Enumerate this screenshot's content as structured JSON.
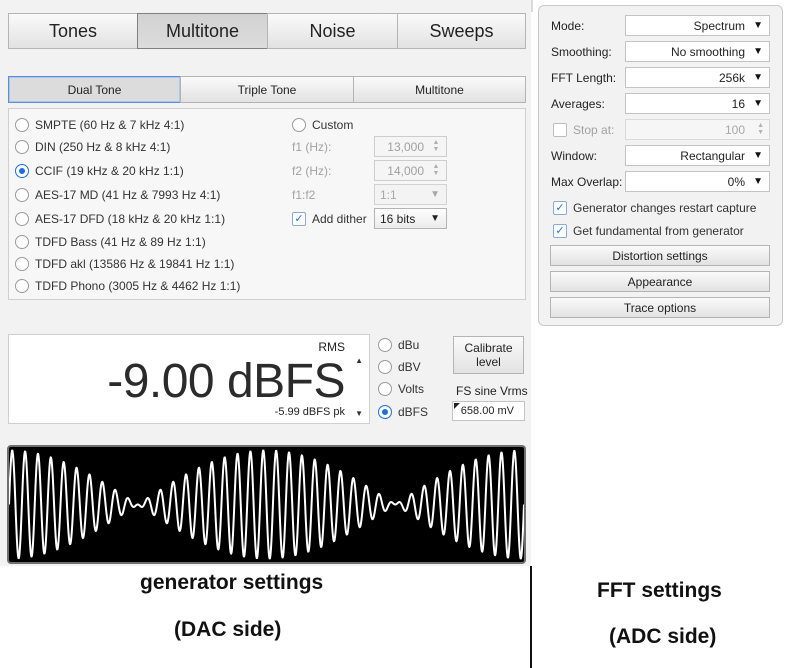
{
  "main_tabs": [
    "Tones",
    "Multitone",
    "Noise",
    "Sweeps"
  ],
  "sub_tabs": [
    "Dual Tone",
    "Triple Tone",
    "Multitone"
  ],
  "presets": [
    {
      "label": "SMPTE (60 Hz & 7 kHz 4:1)",
      "selected": false
    },
    {
      "label": "DIN (250 Hz & 8 kHz 4:1)",
      "selected": false
    },
    {
      "label": "CCIF (19 kHz & 20 kHz 1:1)",
      "selected": true
    },
    {
      "label": "AES-17 MD (41 Hz & 7993 Hz 4:1)",
      "selected": false
    },
    {
      "label": "AES-17 DFD (18 kHz & 20 kHz 1:1)",
      "selected": false
    },
    {
      "label": "TDFD Bass (41 Hz & 89 Hz 1:1)",
      "selected": false
    },
    {
      "label": "TDFD akl (13586 Hz & 19841 Hz 1:1)",
      "selected": false
    },
    {
      "label": "TDFD Phono (3005 Hz & 4462 Hz 1:1)",
      "selected": false
    }
  ],
  "custom": {
    "label": "Custom",
    "f1_label": "f1 (Hz):",
    "f1_value": "13,000",
    "f2_label": "f2 (Hz):",
    "f2_value": "14,000",
    "ratio_label": "f1:f2",
    "ratio_value": "1:1",
    "dither_label": "Add dither",
    "dither_checked": true,
    "dither_bits": "16 bits"
  },
  "level": {
    "rms_label": "RMS",
    "value": "-9.00 dBFS",
    "peak": "-5.99 dBFS pk",
    "units": [
      {
        "label": "dBu",
        "selected": false
      },
      {
        "label": "dBV",
        "selected": false
      },
      {
        "label": "Volts",
        "selected": false
      },
      {
        "label": "dBFS",
        "selected": true
      }
    ],
    "calibrate_line1": "Calibrate",
    "calibrate_line2": "level",
    "fs_label": "FS sine Vrms",
    "fs_value": "658.00 mV"
  },
  "captions": {
    "left_line1": "generator settings",
    "left_line2": "(DAC side)",
    "right_line1": "FFT settings",
    "right_line2": "(ADC side)"
  },
  "fft": {
    "mode_label": "Mode:",
    "mode_value": "Spectrum",
    "smoothing_label": "Smoothing:",
    "smoothing_value": "No smoothing",
    "length_label": "FFT Length:",
    "length_value": "256k",
    "averages_label": "Averages:",
    "averages_value": "16",
    "stop_label": "Stop at:",
    "stop_value": "100",
    "stop_checked": false,
    "window_label": "Window:",
    "window_value": "Rectangular",
    "overlap_label": "Max Overlap:",
    "overlap_value": "0%",
    "restart_label": "Generator changes restart capture",
    "restart_checked": true,
    "fundamental_label": "Get fundamental from generator",
    "fundamental_checked": true,
    "buttons": [
      "Distortion settings",
      "Appearance",
      "Trace options"
    ]
  },
  "waveform": {
    "f1_hz": 19000,
    "f2_hz": 20000,
    "amplitude_ratio": "1:1"
  },
  "colors": {
    "accent": "#1f6fd8",
    "scope_bg": "#000000",
    "trace": "#ffffff"
  }
}
